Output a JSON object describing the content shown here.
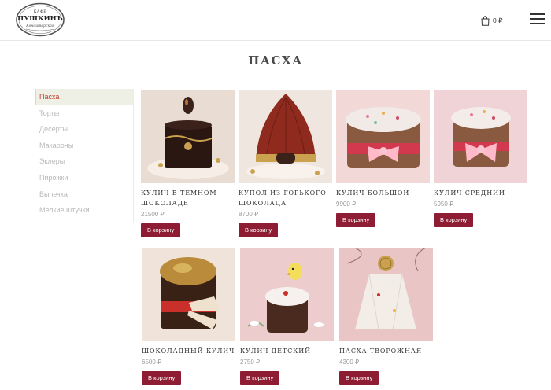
{
  "header": {
    "logo_text": "КАФЕ ПУШКИНЪ Кондитерская",
    "cart_total": "0 ₽",
    "cart_icon": "shopping-bag-icon",
    "menu_icon": "hamburger-menu-icon"
  },
  "page": {
    "title": "ПАСХА"
  },
  "sidebar": {
    "items": [
      {
        "label": "Пасха",
        "active": true
      },
      {
        "label": "Торты"
      },
      {
        "label": "Десерты"
      },
      {
        "label": "Макароны"
      },
      {
        "label": "Эклеры"
      },
      {
        "label": "Пирожки"
      },
      {
        "label": "Выпечка"
      },
      {
        "label": "Мелкие штучки"
      }
    ]
  },
  "products": [
    {
      "name": "Кулич в темном шоколаде",
      "price": "21500 ₽",
      "button": "В корзину"
    },
    {
      "name": "Купол из горького шоколада",
      "price": "8700 ₽",
      "button": "В корзину"
    },
    {
      "name": "Кулич большой",
      "price": "9900 ₽",
      "button": "В корзину"
    },
    {
      "name": "Кулич средний",
      "price": "5950 ₽",
      "button": "В корзину"
    },
    {
      "name": "Шоколадный кулич",
      "price": "6500 ₽",
      "button": "В корзину"
    },
    {
      "name": "Кулич детский",
      "price": "2750 ₽",
      "button": "В корзину"
    },
    {
      "name": "Пасха творожная",
      "price": "4300 ₽",
      "button": "В корзину"
    }
  ],
  "colors": {
    "accent": "#8e1c32",
    "active_link": "#c0392b",
    "active_bg": "#eef0e6"
  }
}
